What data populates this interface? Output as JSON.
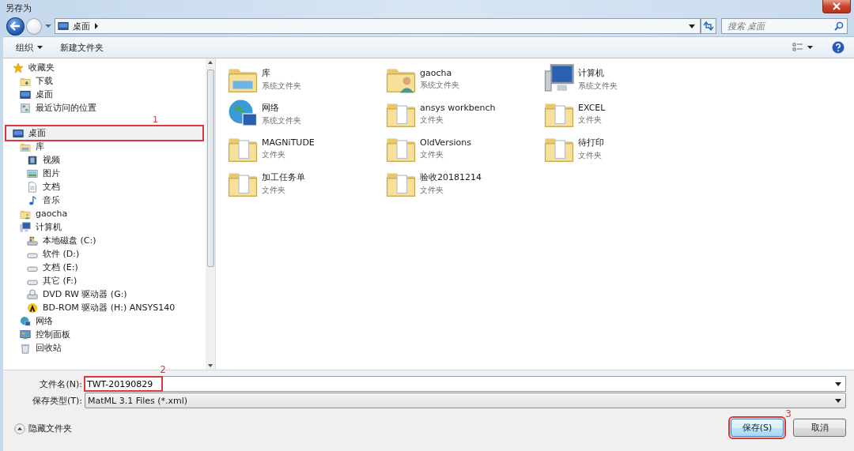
{
  "window": {
    "title": "另存为"
  },
  "address_bar": {
    "location": "桌面"
  },
  "search": {
    "placeholder": "搜索 桌面"
  },
  "toolbar": {
    "organize": "组织",
    "new_folder": "新建文件夹"
  },
  "sidebar": {
    "items": [
      {
        "label": "收藏夹",
        "kind": "star",
        "selected": false,
        "children": [
          {
            "label": "下载",
            "kind": "download",
            "selected": false
          },
          {
            "label": "桌面",
            "kind": "desktop",
            "selected": false
          },
          {
            "label": "最近访问的位置",
            "kind": "recent",
            "selected": false
          }
        ]
      },
      {
        "label": "桌面",
        "kind": "desktop",
        "selected": true,
        "callout": "1",
        "children": [
          {
            "label": "库",
            "kind": "library",
            "selected": false,
            "children": [
              {
                "label": "视频",
                "kind": "video",
                "selected": false
              },
              {
                "label": "图片",
                "kind": "picture",
                "selected": false
              },
              {
                "label": "文档",
                "kind": "doc",
                "selected": false
              },
              {
                "label": "音乐",
                "kind": "music",
                "selected": false
              }
            ]
          },
          {
            "label": "gaocha",
            "kind": "user",
            "selected": false
          },
          {
            "label": "计算机",
            "kind": "computer",
            "selected": false,
            "children": [
              {
                "label": "本地磁盘 (C:)",
                "kind": "disk",
                "selected": false
              },
              {
                "label": "软件 (D:)",
                "kind": "drive",
                "selected": false
              },
              {
                "label": "文档 (E:)",
                "kind": "drive",
                "selected": false
              },
              {
                "label": "其它 (F:)",
                "kind": "drive",
                "selected": false
              },
              {
                "label": "DVD RW 驱动器 (G:)",
                "kind": "dvd",
                "selected": false
              },
              {
                "label": "BD-ROM 驱动器 (H:) ANSYS140",
                "kind": "cd",
                "selected": false
              }
            ]
          },
          {
            "label": "网络",
            "kind": "network",
            "selected": false
          },
          {
            "label": "控制面板",
            "kind": "panel",
            "selected": false
          },
          {
            "label": "回收站",
            "kind": "recycle",
            "selected": false
          }
        ]
      }
    ]
  },
  "content": {
    "items": [
      {
        "name": "库",
        "type": "系统文件夹",
        "kind": "library"
      },
      {
        "name": "gaocha",
        "type": "系统文件夹",
        "kind": "user"
      },
      {
        "name": "计算机",
        "type": "系统文件夹",
        "kind": "computer"
      },
      {
        "name": "网络",
        "type": "系统文件夹",
        "kind": "network"
      },
      {
        "name": "ansys workbench",
        "type": "文件夹",
        "kind": "folder"
      },
      {
        "name": "EXCEL",
        "type": "文件夹",
        "kind": "folder"
      },
      {
        "name": "MAGNiTUDE",
        "type": "文件夹",
        "kind": "folder"
      },
      {
        "name": "OldVersions",
        "type": "文件夹",
        "kind": "folder"
      },
      {
        "name": "待打印",
        "type": "文件夹",
        "kind": "folder"
      },
      {
        "name": "加工任务单",
        "type": "文件夹",
        "kind": "folder"
      },
      {
        "name": "验收20181214",
        "type": "文件夹",
        "kind": "folder"
      }
    ]
  },
  "form": {
    "file_name_label": "文件名(N):",
    "file_name": "TWT-20190829",
    "file_name_callout": "2",
    "file_type_label": "保存类型(T):",
    "file_type": "MatML 3.1 Files (*.xml)"
  },
  "hide_folders": "隐藏文件夹",
  "buttons": [
    {
      "label": "保存(S)",
      "kind": "primary",
      "callout": "3"
    },
    {
      "label": "取消",
      "kind": "normal"
    }
  ]
}
